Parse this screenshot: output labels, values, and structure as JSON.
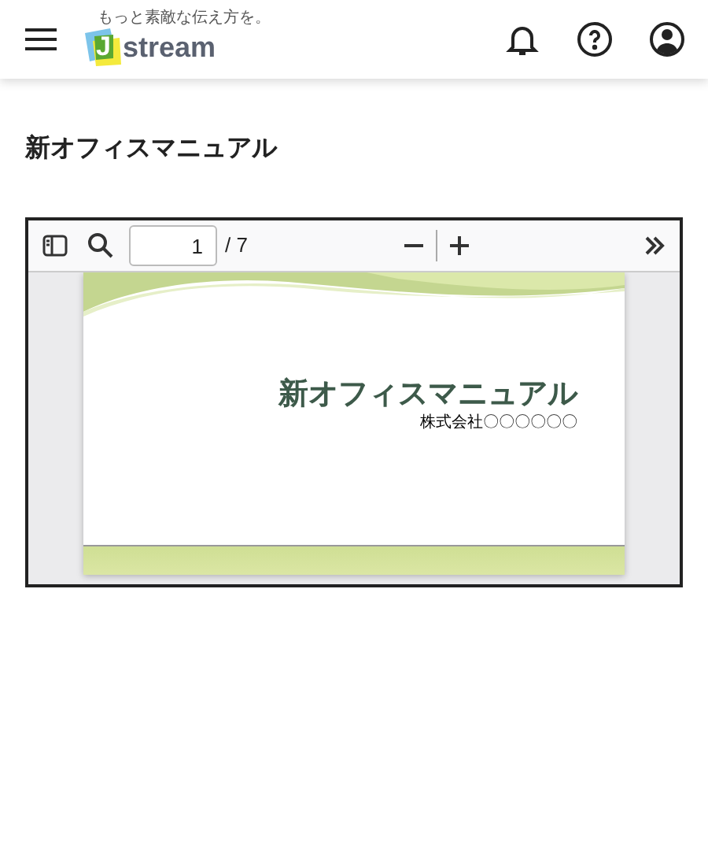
{
  "header": {
    "logo": {
      "tagline": "もっと素敵な伝え方を。",
      "letter": "J",
      "name": "stream"
    }
  },
  "page_title": "新オフィスマニュアル",
  "viewer": {
    "toolbar": {
      "page_number": "1",
      "page_count": "/ 7"
    },
    "slide": {
      "title": "新オフィスマニュアル",
      "subtitle": "株式会社〇〇〇〇〇〇"
    }
  }
}
